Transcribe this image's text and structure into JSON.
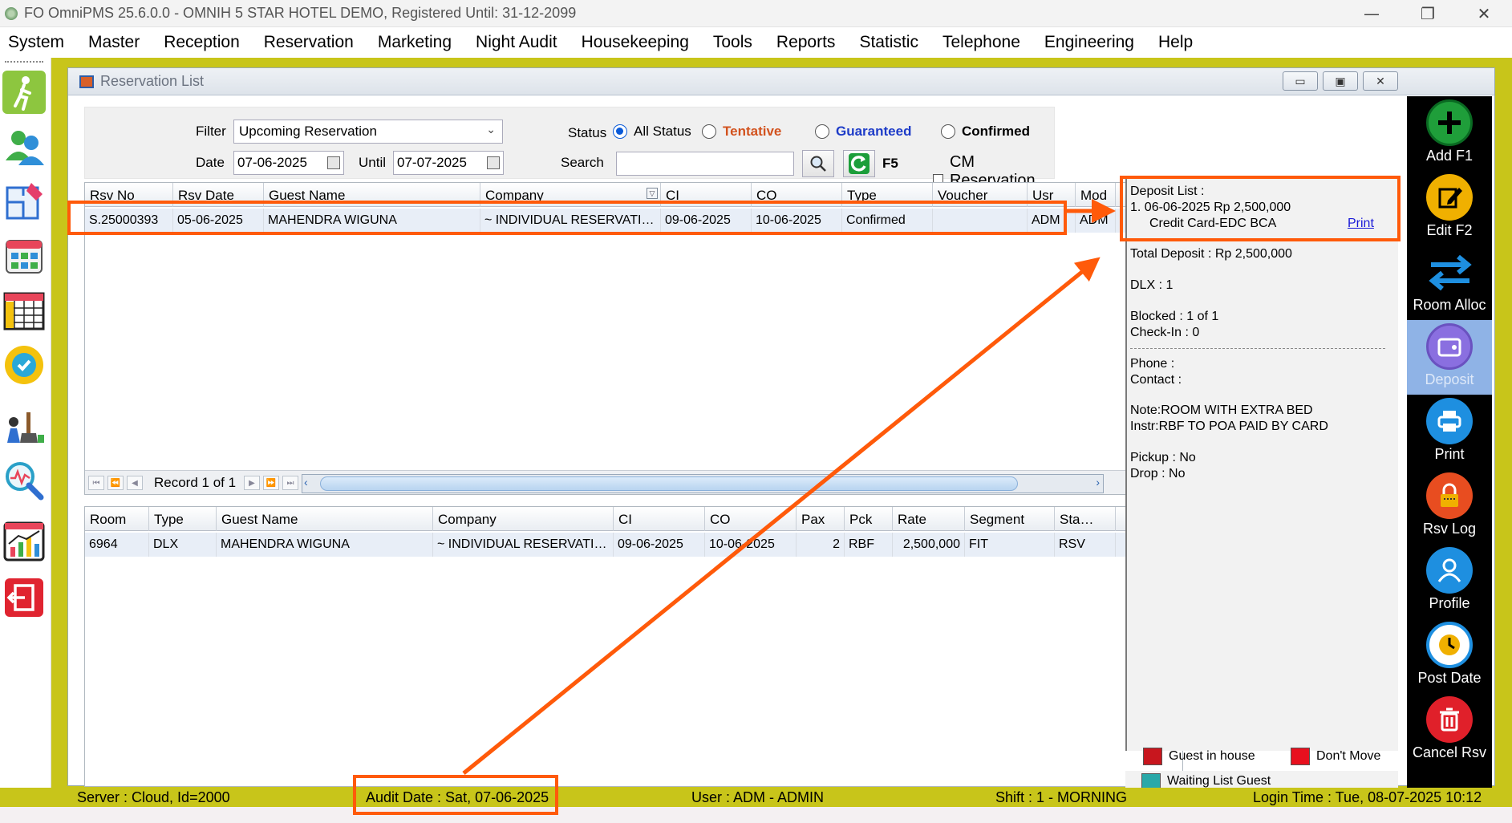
{
  "window": {
    "title": "FO OmniPMS 25.6.0.0 - OMNIH 5 STAR HOTEL DEMO, Registered Until: 31-12-2099",
    "minimize": "—",
    "restore": "❐",
    "close": "✕"
  },
  "menu": [
    "System",
    "Master",
    "Reception",
    "Reservation",
    "Marketing",
    "Night Audit",
    "Housekeeping",
    "Tools",
    "Reports",
    "Statistic",
    "Telephone",
    "Engineering",
    "Help"
  ],
  "form": {
    "title": "Reservation List"
  },
  "filter": {
    "filter_label": "Filter",
    "filter_value": "Upcoming Reservation",
    "date_label": "Date",
    "date_from": "07-06-2025",
    "until_label": "Until",
    "date_until": "07-07-2025",
    "status_label": "Status",
    "status_options": [
      "All Status",
      "Tentative",
      "Guaranteed",
      "Confirmed"
    ],
    "status_selected": "All Status",
    "search_label": "Search",
    "search_value": "",
    "refresh_label": "F5",
    "cm_only_label": "CM Reservation Only"
  },
  "reservations": {
    "columns": [
      "Rsv No",
      "Rsv Date",
      "Guest Name",
      "Company",
      "CI",
      "CO",
      "Type",
      "Voucher",
      "Usr",
      "Mod"
    ],
    "rows": [
      [
        "S.25000393",
        "05-06-2025",
        "MAHENDRA WIGUNA",
        "~ INDIVIDUAL RESERVATI…",
        "09-06-2025",
        "10-06-2025",
        "Confirmed",
        "",
        "ADM",
        "ADM"
      ]
    ],
    "record_text": "Record 1 of 1"
  },
  "rooms": {
    "columns": [
      "Room",
      "Type",
      "Guest Name",
      "Company",
      "CI",
      "CO",
      "Pax",
      "Pck",
      "Rate",
      "Segment",
      "Sta…"
    ],
    "rows": [
      [
        "6964",
        "DLX",
        "MAHENDRA WIGUNA",
        "~ INDIVIDUAL RESERVATI…",
        "09-06-2025",
        "10-06-2025",
        "2",
        "RBF",
        "2,500,000",
        "FIT",
        "RSV"
      ]
    ]
  },
  "info": {
    "deposit_header": "Deposit List :",
    "deposit_line1": "1. 06-06-2025   Rp 2,500,000",
    "deposit_line2": "Credit Card-EDC BCA",
    "print_link": "Print",
    "total_deposit": "Total Deposit : Rp 2,500,000",
    "room_type_count": "DLX : 1",
    "blocked": "Blocked : 1 of 1",
    "checkin": "Check-In : 0",
    "phone": "Phone :",
    "contact": "Contact :",
    "note": "Note:ROOM WITH EXTRA BED",
    "instr": "Instr:RBF TO POA PAID BY CARD",
    "pickup": "Pickup : No",
    "drop": "Drop : No",
    "legend": [
      {
        "label": "Guest in house",
        "color": "#c8161e"
      },
      {
        "label": "Don't Move",
        "color": "#e8101e"
      },
      {
        "label": "Waiting List Guest",
        "color": "#2aa9a9"
      }
    ]
  },
  "actions": [
    {
      "label": "Add F1",
      "icon": "plus-icon",
      "color": "#1f9e3a"
    },
    {
      "label": "Edit F2",
      "icon": "edit-icon",
      "color": "#f0b000"
    },
    {
      "label": "Room Alloc",
      "icon": "swap-icon",
      "color": "#1e8fe0"
    },
    {
      "label": "Deposit",
      "icon": "wallet-icon",
      "color": "#8a6fe0"
    },
    {
      "label": "Print",
      "icon": "printer-icon",
      "color": "#1e8fe0"
    },
    {
      "label": "Rsv Log",
      "icon": "lock-icon",
      "color": "#e84d20"
    },
    {
      "label": "Profile",
      "icon": "user-icon",
      "color": "#1e8fe0"
    },
    {
      "label": "Post Date",
      "icon": "clock-icon",
      "color": "#f0b000"
    },
    {
      "label": "Cancel Rsv",
      "icon": "trash-icon",
      "color": "#e0202a"
    }
  ],
  "status": {
    "server": "Server : Cloud, Id=2000",
    "audit_date": "Audit Date : Sat, 07-06-2025",
    "user": "User : ADM - ADMIN",
    "shift": "Shift : 1 - MORNING",
    "login_time": "Login Time : Tue, 08-07-2025 10:12"
  },
  "colors": {
    "annotation": "#ff5a0a",
    "frame": "#c8c51a",
    "tentative": "#d2521e",
    "guaranteed": "#1e3cc8"
  }
}
